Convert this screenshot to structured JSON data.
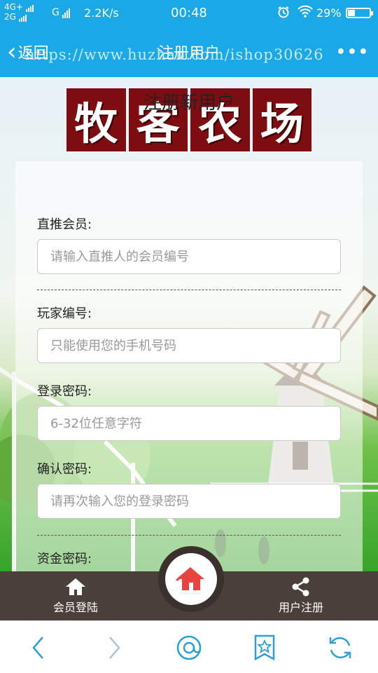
{
  "status_bar": {
    "network_top": "4G+",
    "network_bottom": "2G",
    "signal_g": "G",
    "speed": "2.2K/s",
    "time": "00:48",
    "battery": "29%"
  },
  "header": {
    "back_label": "返回",
    "title": "注册用户",
    "more": "•••",
    "watermark": "https://www.huzhan.com/ishop30626"
  },
  "logo": {
    "chars": [
      "牧",
      "客",
      "农",
      "场"
    ]
  },
  "form": {
    "title": "注册新用户",
    "fields": [
      {
        "label": "直推会员:",
        "placeholder": "请输入直推人的会员编号"
      },
      {
        "label": "玩家编号:",
        "placeholder": "只能使用您的手机号码"
      },
      {
        "label": "登录密码:",
        "placeholder": "6-32位任意字符"
      },
      {
        "label": "确认密码:",
        "placeholder": "请再次输入您的登录密码"
      },
      {
        "label": "资金密码:",
        "placeholder": ""
      }
    ]
  },
  "app_nav": {
    "login_label": "会员登陆",
    "register_label": "用户注册",
    "home_icon": "home-icon"
  },
  "browser_bar": {
    "icons": [
      "back-arrow-icon",
      "forward-arrow-icon",
      "browser-home-icon",
      "bookmark-star-icon",
      "refresh-icon"
    ]
  },
  "colors": {
    "header": "#1aa9e6",
    "logo_bg": "#7d0d10",
    "nav_bg": "#4b3f3a",
    "home_icon": "#e8443f",
    "browser_icon": "#2a9fd8"
  }
}
